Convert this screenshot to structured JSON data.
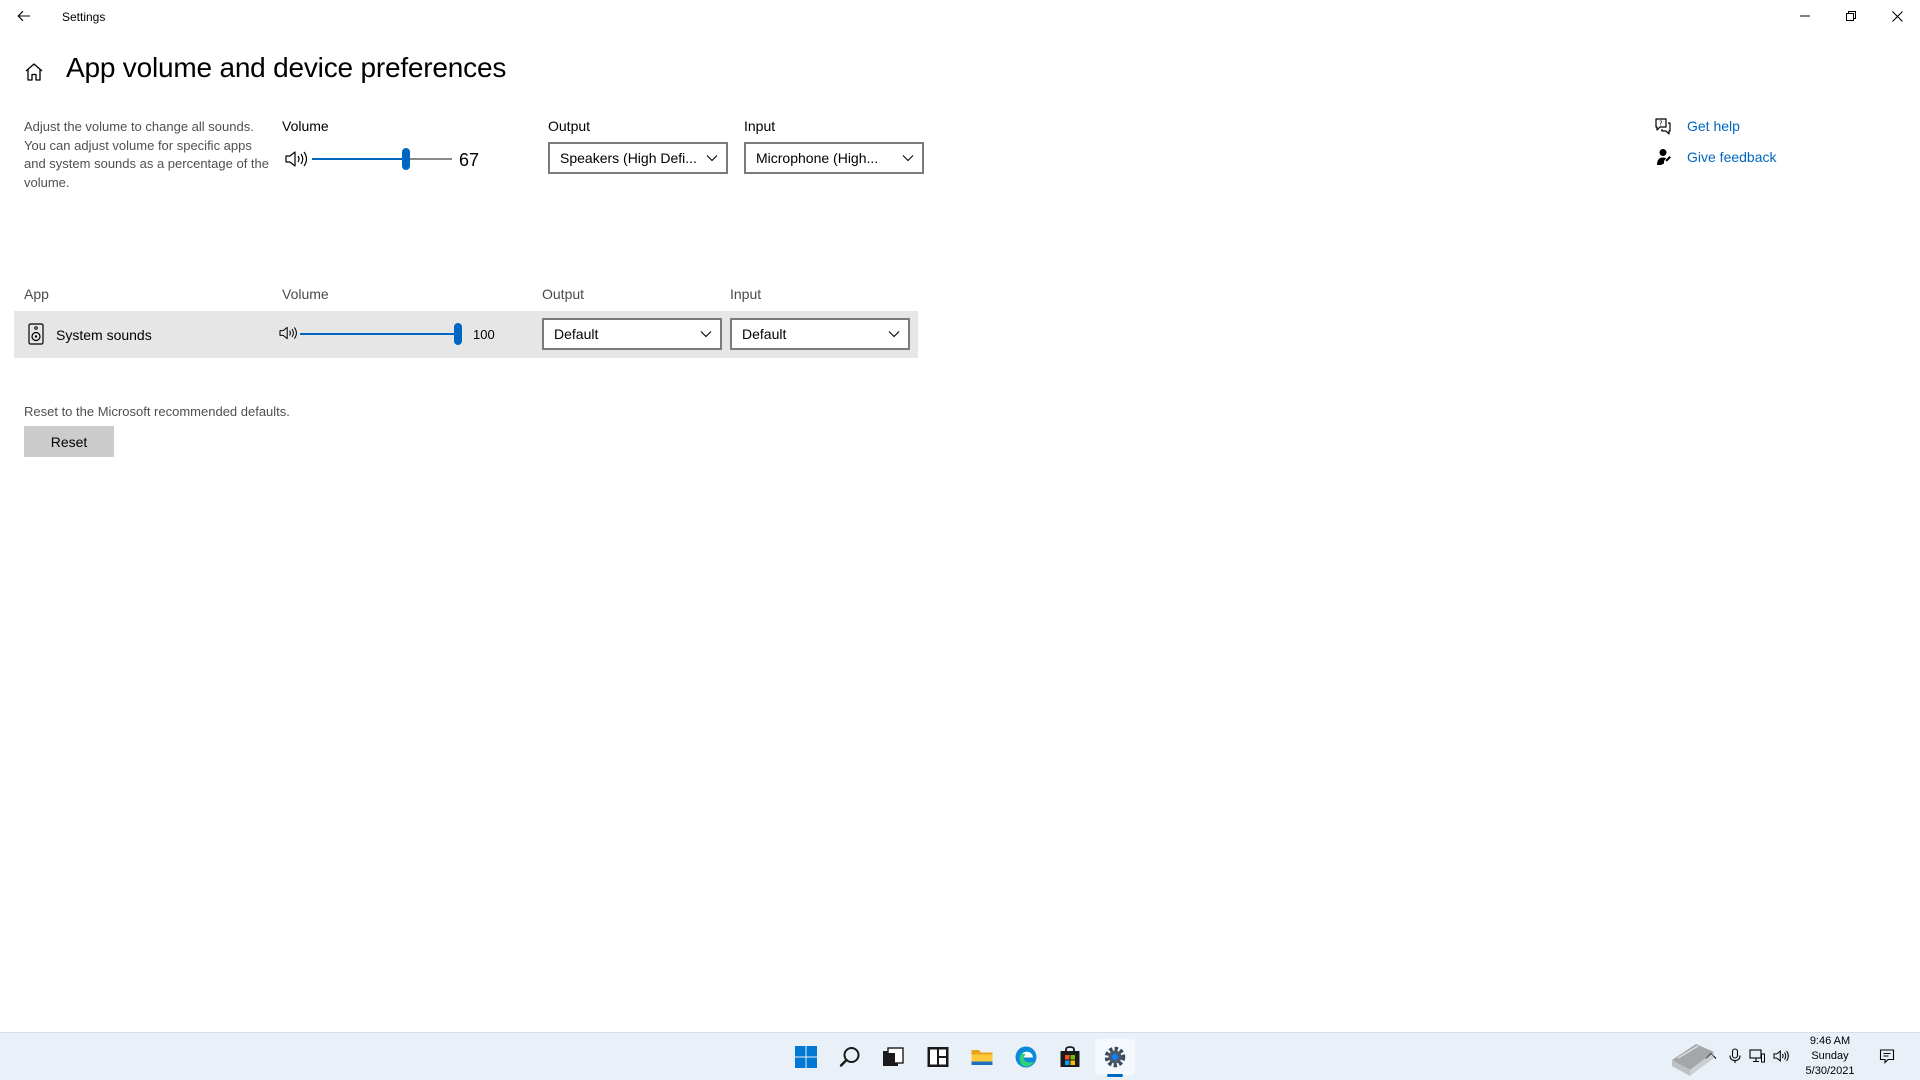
{
  "window": {
    "title": "Settings"
  },
  "page": {
    "title": "App volume and device preferences"
  },
  "master": {
    "description": "Adjust the volume to change all sounds. You can adjust volume for specific apps and system sounds as a percentage of the volume.",
    "volume_label": "Volume",
    "volume_value": "67",
    "volume_level": 67,
    "output_label": "Output",
    "output_value": "Speakers (High Defi...",
    "input_label": "Input",
    "input_value": "Microphone (High..."
  },
  "help": {
    "get_help": "Get help",
    "give_feedback": "Give feedback"
  },
  "apps_table": {
    "headers": {
      "app": "App",
      "volume": "Volume",
      "output": "Output",
      "input": "Input"
    },
    "rows": [
      {
        "name": "System sounds",
        "volume_value": "100",
        "volume_level": 100,
        "output": "Default",
        "input": "Default"
      }
    ]
  },
  "reset": {
    "description": "Reset to the Microsoft recommended defaults.",
    "button_label": "Reset"
  },
  "taskbar": {
    "items": [
      "start-icon",
      "search-icon",
      "task-view-icon",
      "widgets-icon",
      "file-explorer-icon",
      "edge-icon",
      "store-icon",
      "settings-icon"
    ],
    "active_item": "settings-icon",
    "clock_time": "9:46 AM",
    "clock_day": "Sunday",
    "clock_date": "5/30/2021"
  },
  "colors": {
    "accent": "#0067c0",
    "row_background": "#e6e6e6",
    "button_background": "#cccccc",
    "taskbar_background": "#eaf0f8"
  }
}
